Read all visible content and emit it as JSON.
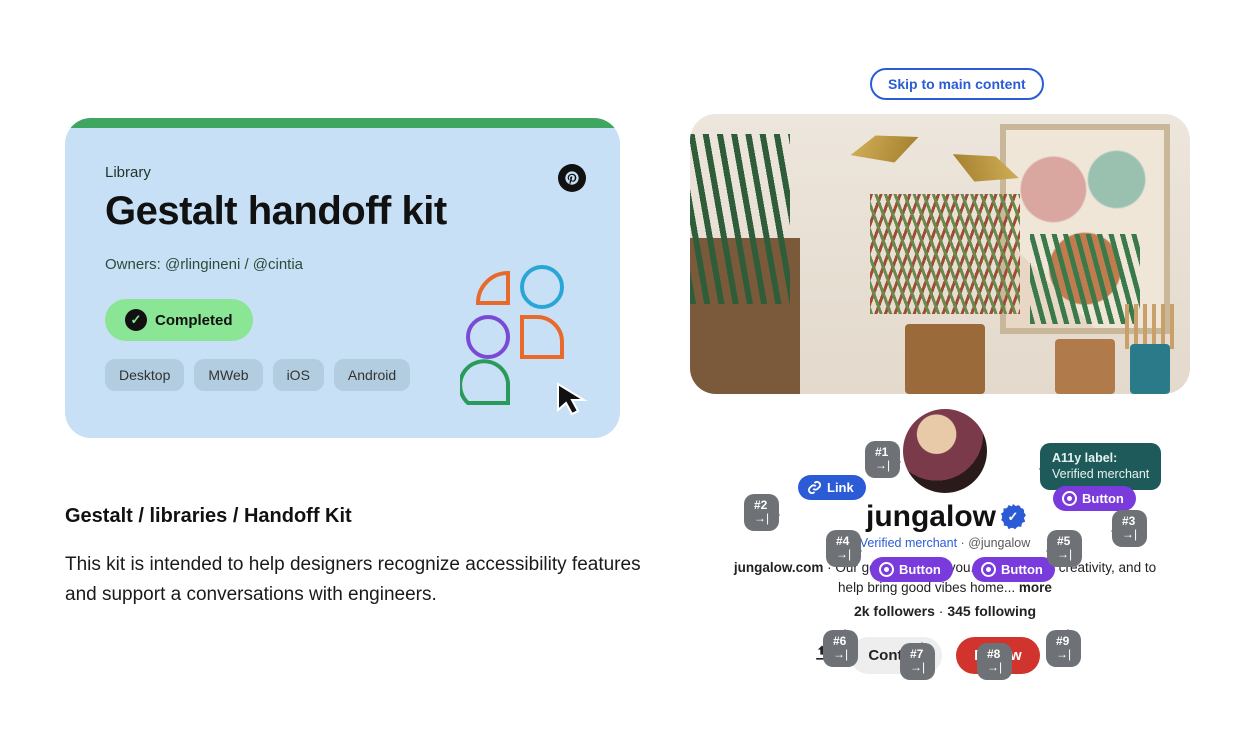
{
  "card": {
    "eyebrow": "Library",
    "title": "Gestalt handoff kit",
    "owners": "Owners: @rlingineni / @cintia",
    "status": "Completed",
    "tags": [
      "Desktop",
      "MWeb",
      "iOS",
      "Android"
    ]
  },
  "desc": {
    "breadcrumb": "Gestalt / libraries / Handoff Kit",
    "body": "This kit is intended to help designers recognize accessibility features and support a conversations with engineers."
  },
  "right": {
    "skip": "Skip to main content",
    "profile_name": "jungalow",
    "verified_text": "Verified merchant",
    "handle": "@jungalow",
    "bio_site": "jungalow.com",
    "bio_rest": " · Our goal is to help you. Tap into your creativity, and to help bring good vibes home... ",
    "bio_more": "more",
    "followers": "2k followers",
    "following": "345 following",
    "contact": "Contact",
    "follow": "Follow"
  },
  "a11y": {
    "label_title": "A11y label:",
    "label_body": "Verified merchant"
  },
  "pills": {
    "link": "Link",
    "button": "Button"
  },
  "annos": {
    "a1": "#1",
    "a2": "#2",
    "a3": "#3",
    "a4": "#4",
    "a5": "#5",
    "a6": "#6",
    "a7": "#7",
    "a8": "#8",
    "a9": "#9",
    "sub": "→|"
  }
}
